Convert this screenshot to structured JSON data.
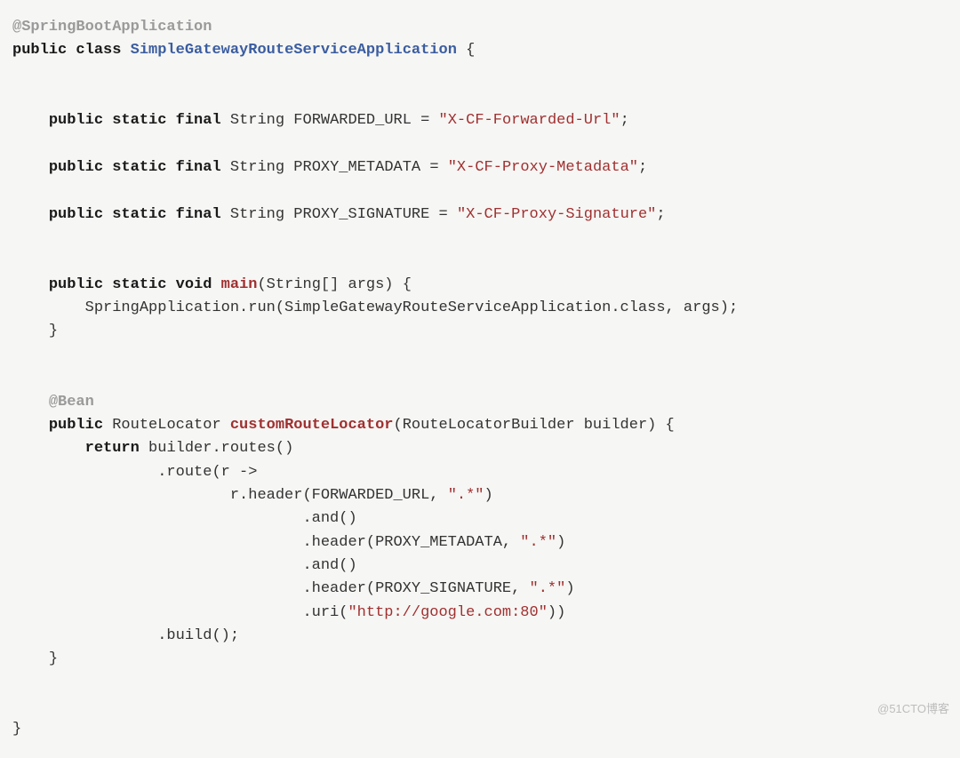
{
  "code": {
    "ann_springboot": "@SpringBootApplication",
    "ann_bean": "@Bean",
    "kw_public": "public",
    "kw_class": "class",
    "kw_static": "static",
    "kw_final": "final",
    "kw_void": "void",
    "kw_return": "return",
    "class_name": "SimpleGatewayRouteServiceApplication",
    "type_string": "String",
    "field1": "FORWARDED_URL",
    "field2": "PROXY_METADATA",
    "field3": "PROXY_SIGNATURE",
    "val1": "\"X-CF-Forwarded-Url\"",
    "val2": "\"X-CF-Proxy-Metadata\"",
    "val3": "\"X-CF-Proxy-Signature\"",
    "main_name": "main",
    "main_params": "(String[] args) {",
    "main_body": "SpringApplication.run(SimpleGatewayRouteServiceApplication.class, args);",
    "crl_return_type": "RouteLocator",
    "crl_name": "customRouteLocator",
    "crl_params": "(RouteLocatorBuilder builder) {",
    "routes": "builder.routes()",
    "route_open": ".route(r ->",
    "header_call": "r.header(FORWARDED_URL, ",
    "header_call2": ".header(PROXY_METADATA, ",
    "header_call3": ".header(PROXY_SIGNATURE, ",
    "regex": "\".*\"",
    "and": ".and()",
    "uri_call": ".uri(",
    "uri_val": "\"http://google.com:80\"",
    "close_paren2": "))",
    "build": ".build();",
    "open_brace": "{",
    "close_brace": "}",
    "eq": " = ",
    "semi": ";",
    "paren_close": ")"
  },
  "watermark": "@51CTO博客"
}
